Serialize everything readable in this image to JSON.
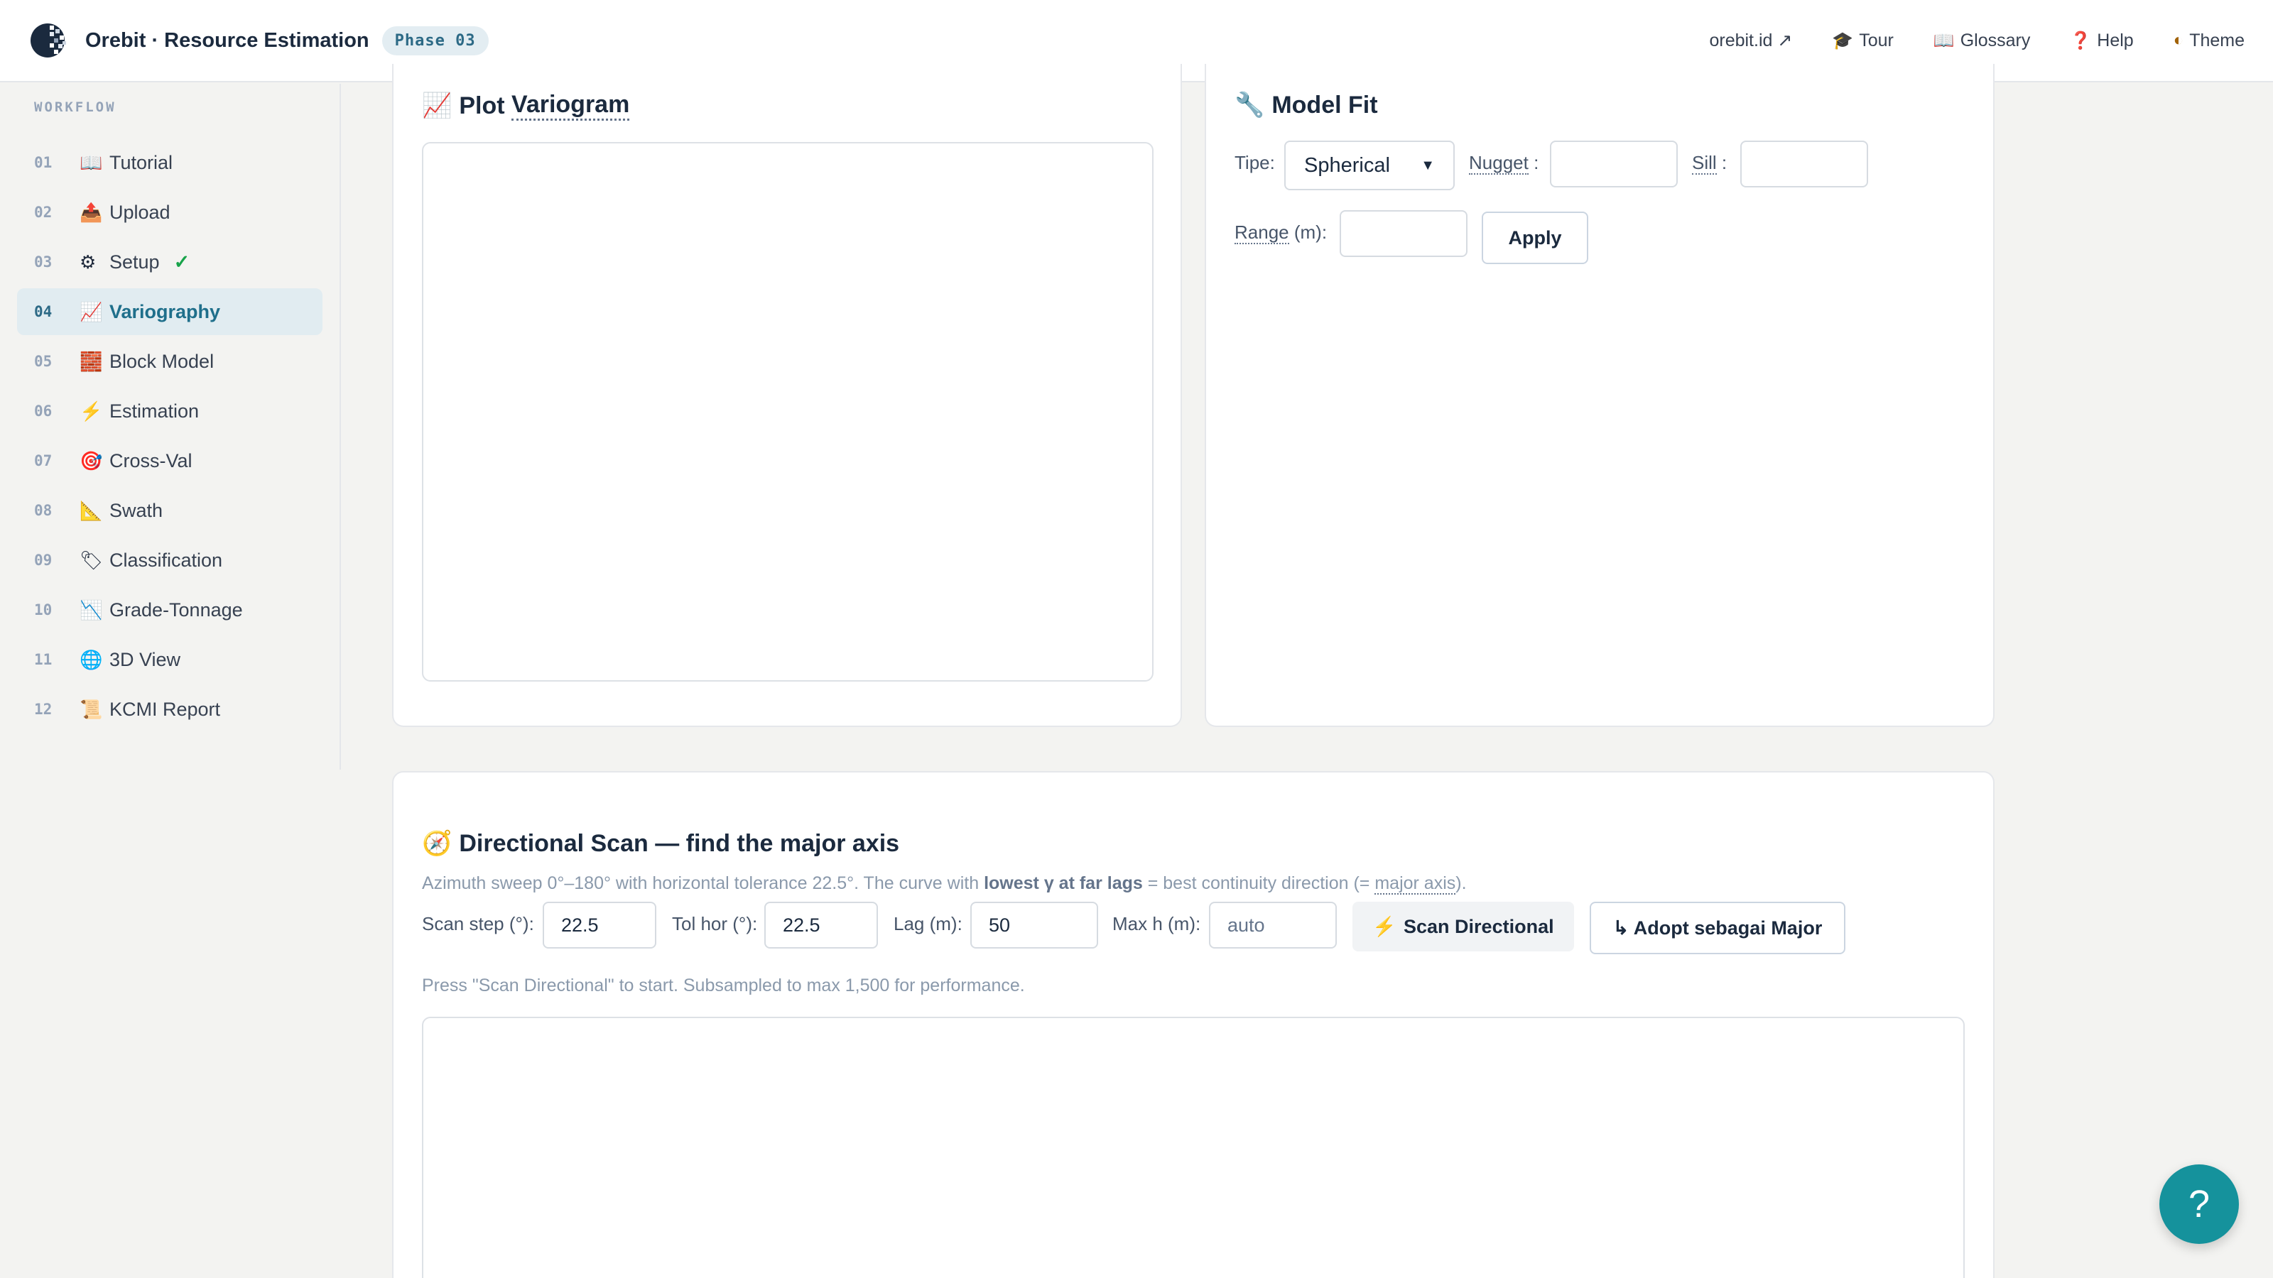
{
  "header": {
    "app_title": "Orebit · Resource Estimation",
    "phase_badge": "Phase 03",
    "nav": [
      {
        "label": "orebit.id ↗",
        "icon": ""
      },
      {
        "label": "Tour",
        "icon": "🎓"
      },
      {
        "label": "Glossary",
        "icon": "📖"
      },
      {
        "label": "Help",
        "icon": "❓"
      },
      {
        "label": "Theme",
        "icon": "◐"
      }
    ]
  },
  "sidebar": {
    "heading": "WORKFLOW",
    "items": [
      {
        "num": "01",
        "icon": "📖",
        "label": "Tutorial"
      },
      {
        "num": "02",
        "icon": "📤",
        "label": "Upload"
      },
      {
        "num": "03",
        "icon": "⚙",
        "label": "Setup",
        "check": "✓"
      },
      {
        "num": "04",
        "icon": "📈",
        "label": "Variography",
        "active": true
      },
      {
        "num": "05",
        "icon": "🧱",
        "label": "Block Model"
      },
      {
        "num": "06",
        "icon": "⚡",
        "label": "Estimation"
      },
      {
        "num": "07",
        "icon": "🎯",
        "label": "Cross-Val"
      },
      {
        "num": "08",
        "icon": "📐",
        "label": "Swath"
      },
      {
        "num": "09",
        "icon": "🏷",
        "label": "Classification"
      },
      {
        "num": "10",
        "icon": "📉",
        "label": "Grade-Tonnage"
      },
      {
        "num": "11",
        "icon": "🌐",
        "label": "3D View"
      },
      {
        "num": "12",
        "icon": "📜",
        "label": "KCMI Report"
      }
    ]
  },
  "plot_card": {
    "icon": "📈",
    "title_prefix": "Plot ",
    "title_term": "Variogram"
  },
  "model_fit": {
    "icon": "🔧",
    "title": "Model Fit",
    "type_label": "Tipe:",
    "type_value": "Spherical",
    "nugget_label": "Nugget",
    "sill_label": "Sill",
    "colon": ":",
    "range_label": "Range",
    "range_unit": "(m):",
    "nugget_value": "",
    "sill_value": "",
    "range_value": "",
    "apply_label": "Apply"
  },
  "directional": {
    "icon": "🧭",
    "title": "Directional Scan — find the major axis",
    "desc_1": "Azimuth sweep 0°–180° with horizontal tolerance 22.5°. The curve with ",
    "desc_bold": "lowest γ at far lags",
    "desc_2": " = best continuity direction (= ",
    "desc_term": "major axis",
    "desc_3": ").",
    "scan_step_label": "Scan step (°):",
    "scan_step_value": "22.5",
    "tol_hor_label": "Tol hor (°):",
    "tol_hor_value": "22.5",
    "lag_label": "Lag (m):",
    "lag_value": "50",
    "max_h_label": "Max h (m):",
    "max_h_placeholder": "auto",
    "scan_button_icon": "⚡",
    "scan_button": "Scan Directional",
    "adopt_button": "↳ Adopt sebagai Major",
    "status": "Press \"Scan Directional\" to start. Subsampled to max 1,500 for performance."
  },
  "fab_label": "?"
}
